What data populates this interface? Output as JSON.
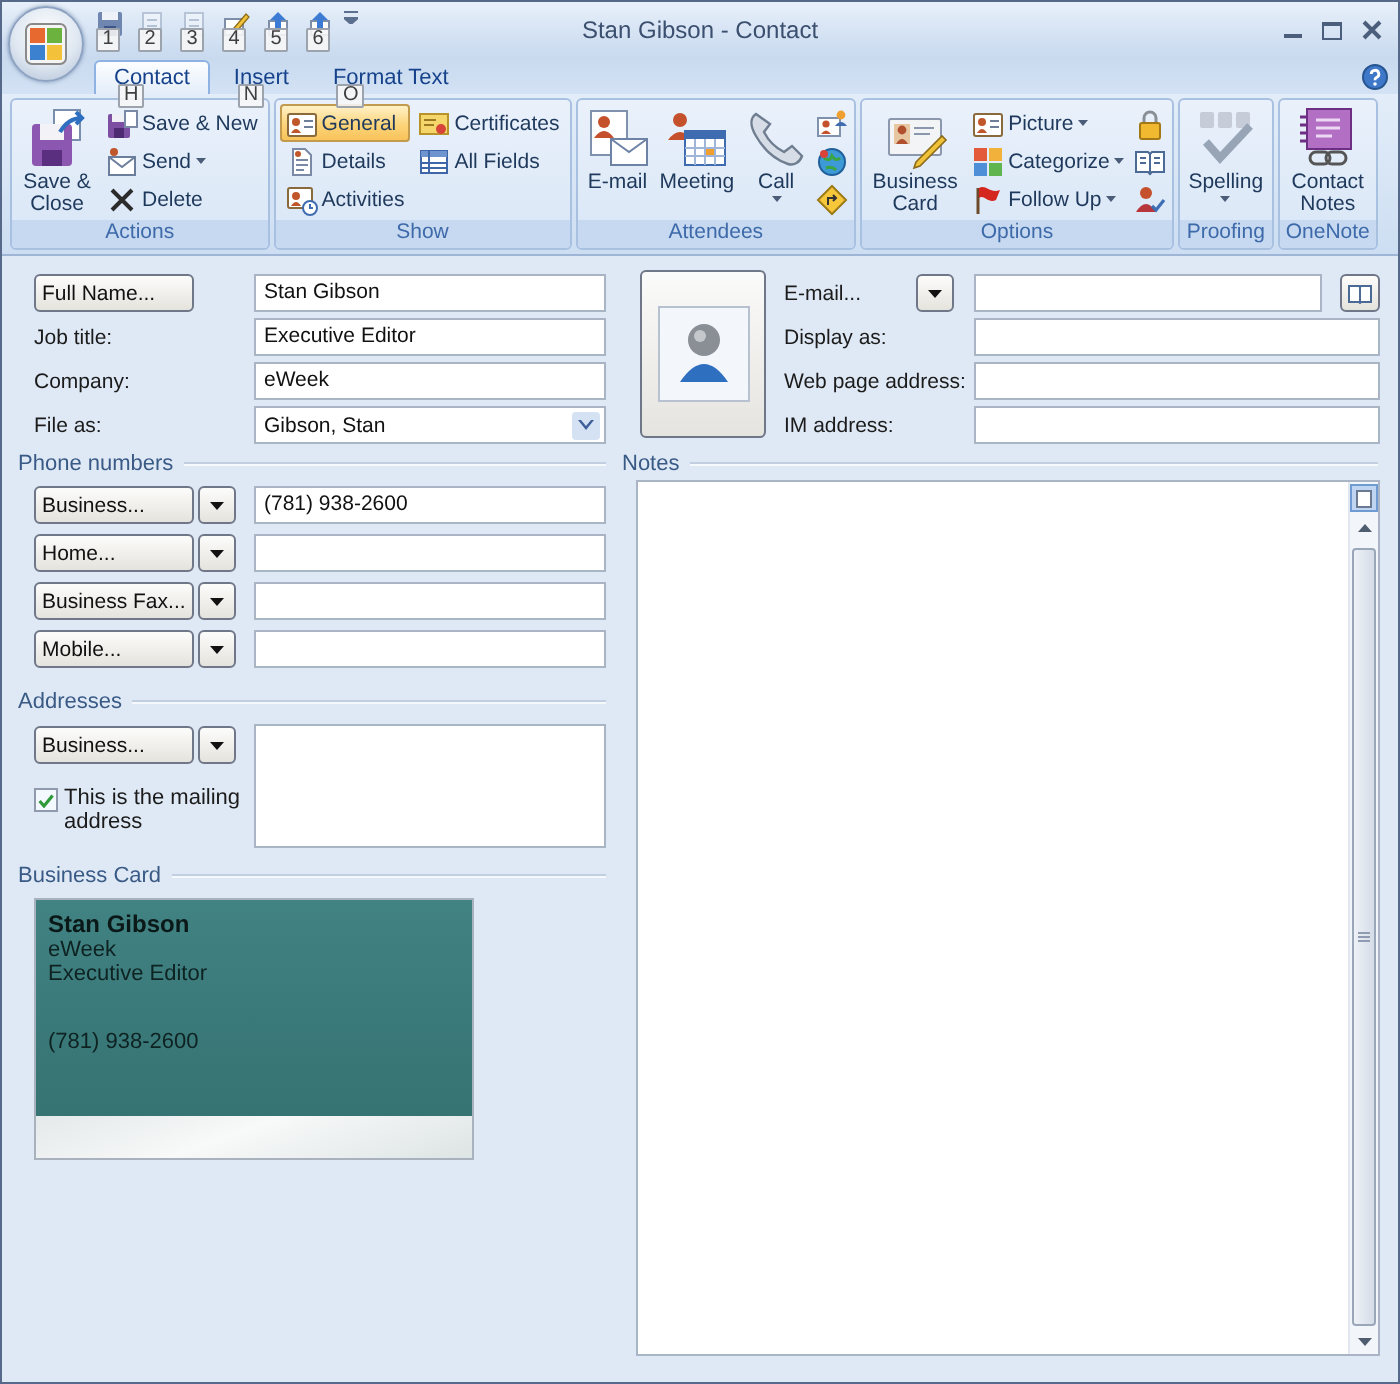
{
  "window": {
    "title": "Stan Gibson - Contact"
  },
  "quick_access": [
    {
      "keytip": "1",
      "disabled": false
    },
    {
      "keytip": "2",
      "disabled": true
    },
    {
      "keytip": "3",
      "disabled": true
    },
    {
      "keytip": "4",
      "disabled": false
    },
    {
      "keytip": "5",
      "disabled": false
    },
    {
      "keytip": "6",
      "disabled": false
    }
  ],
  "tabs": [
    {
      "label": "Contact",
      "selected": true,
      "keytip": "H"
    },
    {
      "label": "Insert",
      "selected": false,
      "keytip": "N"
    },
    {
      "label": "Format Text",
      "selected": false,
      "keytip": "O"
    }
  ],
  "ribbon": [
    {
      "name": "Actions",
      "items": [
        {
          "kind": "large",
          "label": "Save & Close"
        },
        {
          "kind": "small",
          "label": "Save & New"
        },
        {
          "kind": "small",
          "label": "Send",
          "dropdown": true
        },
        {
          "kind": "small",
          "label": "Delete"
        }
      ]
    },
    {
      "name": "Show",
      "items": [
        {
          "kind": "small",
          "label": "General",
          "selected": true
        },
        {
          "kind": "small",
          "label": "Details",
          "selected": false
        },
        {
          "kind": "small",
          "label": "Activities",
          "selected": false
        },
        {
          "kind": "small",
          "label": "Certificates",
          "selected": false
        },
        {
          "kind": "small",
          "label": "All Fields",
          "selected": false
        }
      ]
    },
    {
      "name": "Attendees",
      "items": [
        {
          "kind": "large",
          "label": "E-mail"
        },
        {
          "kind": "large",
          "label": "Meeting"
        },
        {
          "kind": "large",
          "label": "Call",
          "dropdown": true
        },
        {
          "kind": "icon"
        },
        {
          "kind": "icon"
        },
        {
          "kind": "icon"
        }
      ]
    },
    {
      "name": "Options",
      "items": [
        {
          "kind": "large",
          "label": "Business Card"
        },
        {
          "kind": "small",
          "label": "Picture",
          "dropdown": true
        },
        {
          "kind": "small",
          "label": "Categorize",
          "dropdown": true
        },
        {
          "kind": "small",
          "label": "Follow Up",
          "dropdown": true
        },
        {
          "kind": "icon"
        },
        {
          "kind": "icon"
        },
        {
          "kind": "icon"
        }
      ]
    },
    {
      "name": "Proofing",
      "items": [
        {
          "kind": "large",
          "label": "Spelling",
          "dropdown": true
        }
      ]
    },
    {
      "name": "OneNote",
      "items": [
        {
          "kind": "large",
          "label": "Contact Notes"
        }
      ]
    }
  ],
  "general": {
    "name_fields": [
      {
        "kind": "button",
        "label": "Full Name...",
        "value": "Stan Gibson"
      },
      {
        "kind": "label",
        "label": "Job title:",
        "value": "Executive Editor"
      },
      {
        "kind": "label",
        "label": "Company:",
        "value": "eWeek"
      },
      {
        "kind": "combo",
        "label": "File as:",
        "value": "Gibson, Stan"
      }
    ],
    "internet_fields": [
      {
        "kind": "email",
        "label": "E-mail..."
      },
      {
        "kind": "label",
        "label": "Display as:"
      },
      {
        "kind": "label",
        "label": "Web page address:"
      },
      {
        "kind": "label",
        "label": "IM address:"
      }
    ],
    "phone_numbers": {
      "title": "Phone numbers",
      "rows": [
        {
          "label": "Business...",
          "value": "(781) 938-2600"
        },
        {
          "label": "Home..."
        },
        {
          "label": "Business Fax..."
        },
        {
          "label": "Mobile..."
        }
      ]
    },
    "addresses": {
      "title": "Addresses",
      "type": "Business...",
      "mailing_address": {
        "label": "This is the mailing address",
        "checked": true
      }
    },
    "business_card": {
      "title": "Business Card",
      "name": "Stan Gibson",
      "company": "eWeek",
      "job_title": "Executive Editor",
      "phone": "(781) 938-2600"
    },
    "notes": {
      "title": "Notes"
    }
  }
}
